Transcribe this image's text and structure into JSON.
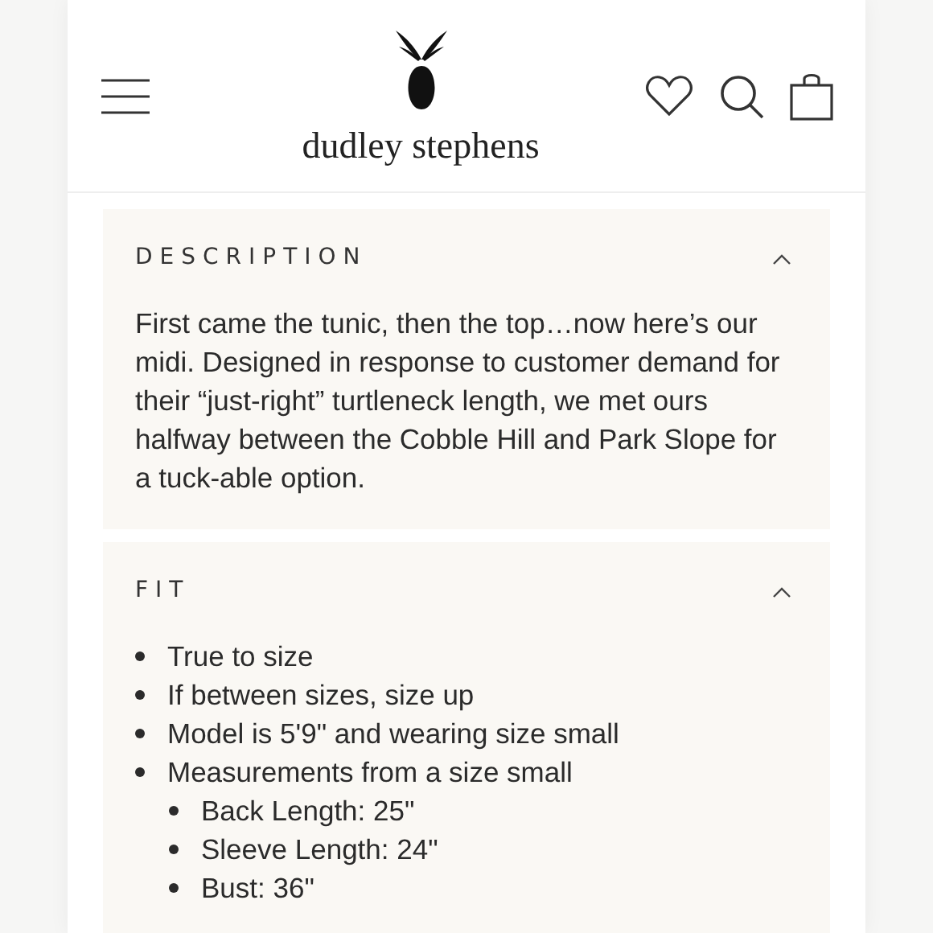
{
  "header": {
    "brand": "dudley stephens"
  },
  "sections": [
    {
      "title": "DESCRIPTION",
      "expanded": true,
      "kind": "paragraph",
      "text": "First came the tunic, then the top…now here’s our midi. Designed in response to customer demand for their “just-right” turtleneck length, we met ours halfway between the Cobble Hill and Park Slope for a tuck-able option."
    },
    {
      "title": "FIT",
      "expanded": true,
      "kind": "list",
      "items": [
        {
          "text": "True to size"
        },
        {
          "text": "If between sizes, size up"
        },
        {
          "text": "Model is 5'9\" and wearing size small"
        },
        {
          "text": "Measurements from a size small",
          "children": [
            {
              "text": "Back Length: 25\""
            },
            {
              "text": "Sleeve Length: 24\""
            },
            {
              "text": "Bust: 36\""
            }
          ]
        }
      ]
    }
  ]
}
